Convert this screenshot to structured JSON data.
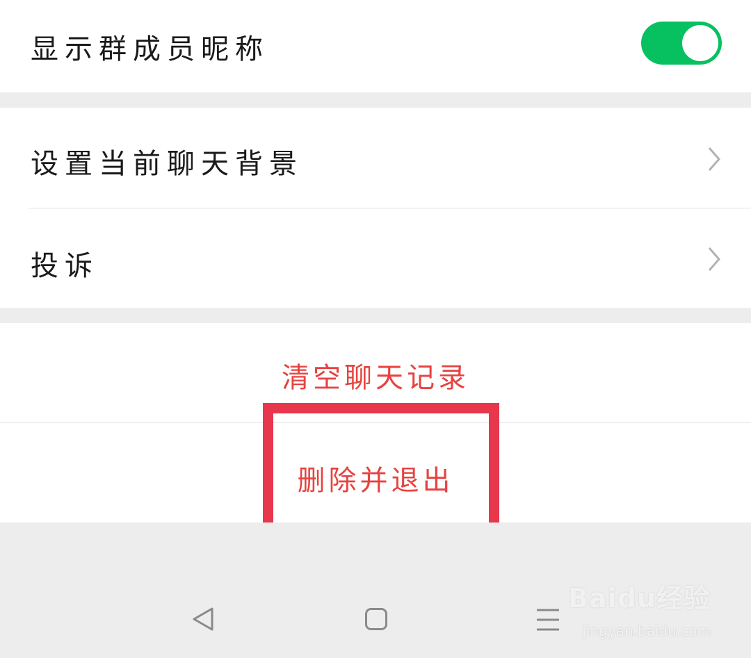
{
  "settings": {
    "show_member_nickname": {
      "label": "显示群成员昵称",
      "enabled": true
    },
    "chat_background": {
      "label": "设置当前聊天背景"
    },
    "complaint": {
      "label": "投诉"
    }
  },
  "actions": {
    "clear_history": "清空聊天记录",
    "delete_and_exit": "删除并退出"
  },
  "colors": {
    "toggle_on": "#07c160",
    "danger_text": "#e64340",
    "highlight_border": "#e8364d",
    "background": "#ededed"
  },
  "nav": {
    "icons": [
      "back-triangle-icon",
      "home-square-icon",
      "menu-lines-icon"
    ]
  },
  "watermark": {
    "logo": "Baidu经验",
    "url": "jingyan.baidu.com"
  }
}
